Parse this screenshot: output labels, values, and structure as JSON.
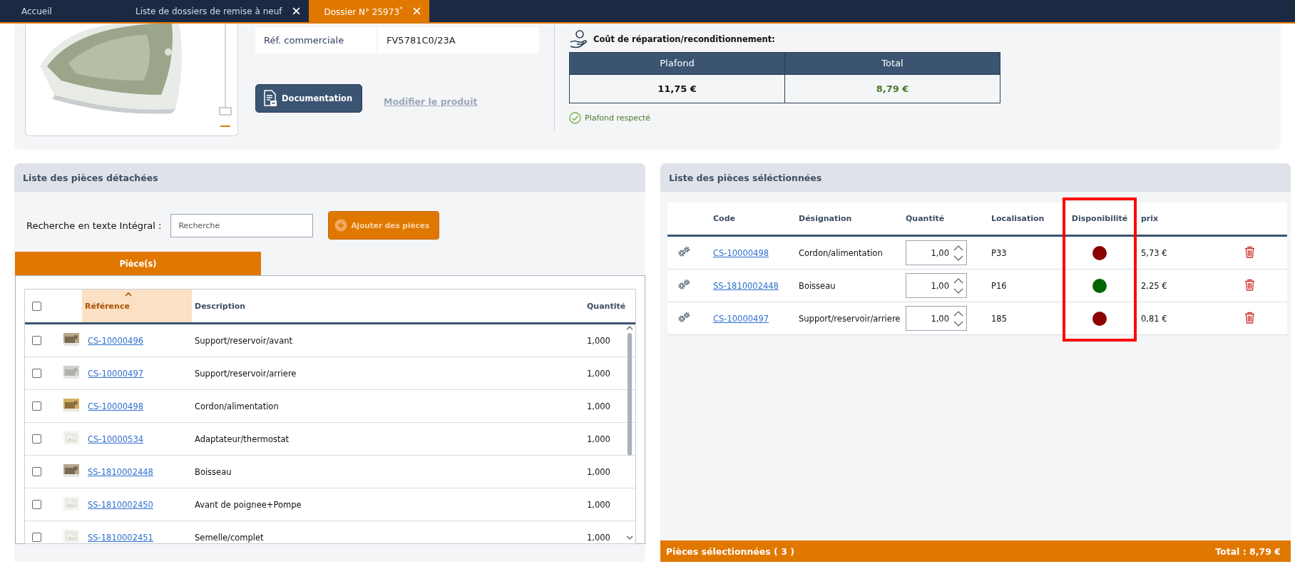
{
  "tabs": [
    {
      "label": "Accueil",
      "selected": false,
      "closable": false
    },
    {
      "label": "Liste de dossiers de remise à neuf",
      "selected": false,
      "closable": true
    },
    {
      "label": "Dossier N° 25973$^{*}$",
      "selected": true,
      "closable": true
    }
  ],
  "product": {
    "ref_label": "Réf. commerciale",
    "ref_value": "FV5781C0/23A",
    "documentation_button": "Documentation",
    "modify_link": {
      "label": "Modifier le produit",
      "disabled": true
    }
  },
  "cost": {
    "title": "Coût de réparation/reconditionnement:",
    "columns": [
      "Plafond",
      "Total"
    ],
    "values": [
      "11,75 €",
      "8,79 €"
    ],
    "respected": true,
    "status": "Plafond respecté"
  },
  "parts_panel": {
    "title": "Liste des pièces détachées",
    "search_label": "Recherche en texte Intégral :",
    "search_placeholder": "Recherche",
    "add_button": {
      "label": "Ajouter des pièces",
      "disabled": true
    },
    "tabs": [
      {
        "label": "Pièce(s)",
        "selected": true
      }
    ],
    "table": {
      "columns": [
        {
          "kind": "checkbox",
          "checked": false
        },
        {
          "kind": "thumb"
        },
        {
          "kind": "text",
          "label": "Référence",
          "sorted": true
        },
        {
          "kind": "text",
          "label": "Description",
          "sorted": false
        },
        {
          "kind": "text",
          "label": "Quantité",
          "sorted": false
        }
      ],
      "rows": [
        {
          "checked": false,
          "reference": "CS-10000496",
          "description": "Support/reservoir/avant",
          "quantity": "1,000"
        },
        {
          "checked": false,
          "reference": "CS-10000497",
          "description": "Support/reservoir/arriere",
          "quantity": "1,000"
        },
        {
          "checked": false,
          "reference": "CS-10000498",
          "description": "Cordon/alimentation",
          "quantity": "1,000"
        },
        {
          "checked": false,
          "thumbnail": {
            "kind": "placeholder"
          },
          "reference": "CS-10000534",
          "description": "Adaptateur/thermostat",
          "quantity": "1,000"
        },
        {
          "checked": false,
          "reference": "SS-1810002448",
          "description": "Boisseau",
          "quantity": "1,000"
        },
        {
          "checked": false,
          "thumbnail": {
            "kind": "placeholder"
          },
          "reference": "SS-1810002450",
          "description": "Avant de poignee+Pompe",
          "quantity": "1,000"
        },
        {
          "checked": false,
          "thumbnail": {
            "kind": "placeholder"
          },
          "reference": "SS-1810002451",
          "description": "Semelle/complet",
          "quantity": "1,000"
        }
      ]
    }
  },
  "selected_panel": {
    "title": "Liste des pièces séléctionnées",
    "columns": [
      {
        "label": "Code",
        "highlighted": false
      },
      {
        "label": "Désignation",
        "highlighted": false
      },
      {
        "label": "Quantité",
        "highlighted": false
      },
      {
        "label": "Localisation",
        "highlighted": false
      },
      {
        "label": "Disponibilité",
        "highlighted": true
      },
      {
        "label": "prix",
        "highlighted": false
      }
    ],
    "rows": [
      {
        "code": "CS-10000498",
        "designation": "Cordon/alimentation",
        "quantity": "1,00",
        "location": "P33",
        "color": "#8b0000",
        "price": "5,73 €"
      },
      {
        "code": "SS-1810002448",
        "designation": "Boisseau",
        "quantity": "1,00",
        "location": "P16",
        "color": "#006400",
        "price": "2,25 €"
      },
      {
        "code": "CS-10000497",
        "designation": "Support/reservoir/arriere",
        "quantity": "1,00",
        "location": "185",
        "color": "#8b0000",
        "price": "0,81 €"
      }
    ],
    "footer": {
      "count": "Pièces sélectionnées ( 3 )",
      "total": "Total : 8,79 €"
    }
  }
}
